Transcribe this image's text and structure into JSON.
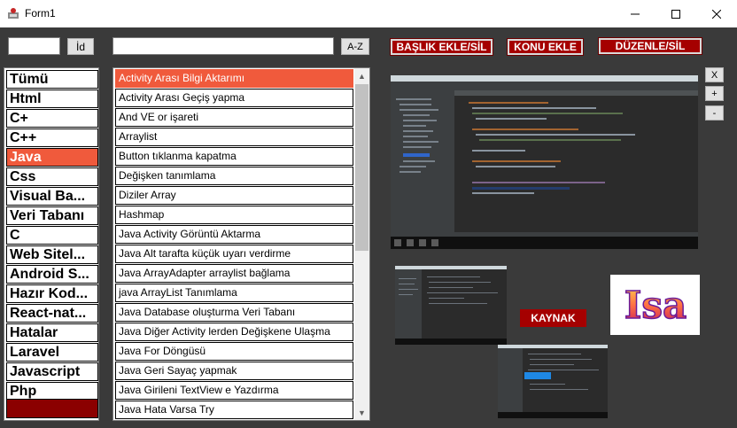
{
  "window": {
    "title": "Form1",
    "minimize": "—",
    "maximize": "☐",
    "close": "✕"
  },
  "toolbar": {
    "id_value": "",
    "id_button": "İd",
    "search_value": "",
    "az_button": "A-Z",
    "baslik_button": "BAŞLIK EKLE/SİL",
    "konu_button": "KONU EKLE",
    "duzenle_button": "DÜZENLE/SİL"
  },
  "side_buttons": {
    "x": "X",
    "plus": "+",
    "minus": "-"
  },
  "kaynak_button": "KAYNAK",
  "logo_text": "Isa",
  "categories": [
    "Tümü",
    "Html",
    "C+",
    "C++",
    "Java",
    "Css",
    "Visual Ba...",
    "Veri Tabanı",
    "C",
    "Web Sitel...",
    "Android S...",
    "Hazır Kod...",
    "React-nat...",
    "Hatalar",
    "Laravel",
    "Javascript",
    "Php"
  ],
  "selected_category": "Java",
  "topics": [
    "Activity Arası Bilgi Aktarımı",
    "Activity Arası Geçiş yapma",
    "And VE or işareti",
    "Arraylist",
    "Button tıklanma kapatma",
    "Değişken tanımlama",
    "Diziler Array",
    "Hashmap",
    "Java Activity Görüntü Aktarma",
    "Java Alt tarafta küçük uyarı verdirme",
    "Java ArrayAdapter arraylist bağlama",
    "java ArrayList Tanımlama",
    "Java Database oluşturma Veri Tabanı",
    "Java Diğer Activity lerden Değişkene Ulaşma",
    "Java For Döngüsü",
    "Java Geri Sayaç yapmak",
    "Java Girileni TextView e Yazdırma",
    "Java Hata Varsa Try"
  ],
  "selected_topic": "Activity Arası Bilgi Aktarımı",
  "colors": {
    "accent": "#f05a3c",
    "dark_red": "#a50000",
    "background": "#3a3a3a"
  },
  "icons": {
    "scroll_up": "▲",
    "scroll_down": "▼"
  }
}
